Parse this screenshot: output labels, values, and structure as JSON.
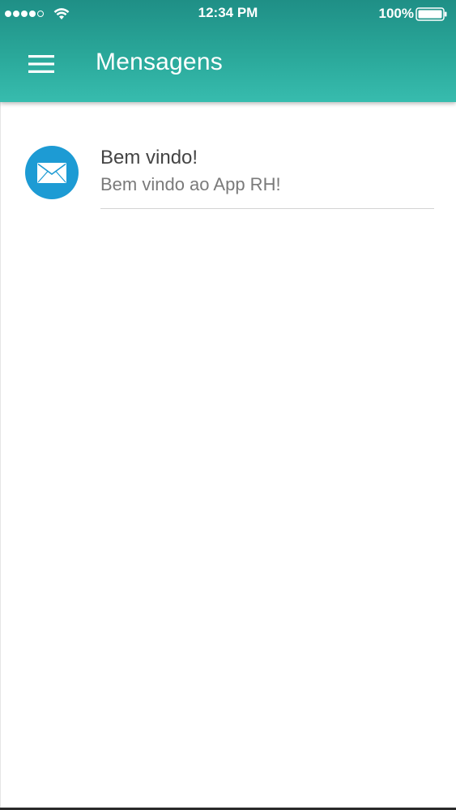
{
  "status_bar": {
    "time": "12:34 PM",
    "battery_percent": "100%",
    "signal_bars": 4,
    "signal_icon": "cellular-signal-icon",
    "wifi_icon": "wifi-icon",
    "battery_icon": "battery-icon"
  },
  "header": {
    "title": "Mensagens",
    "menu_icon": "hamburger-menu-icon",
    "color_top": "#1f8f86",
    "color_bottom": "#37bcae"
  },
  "messages": [
    {
      "title": "Bem vindo!",
      "subtitle": "Bem vindo ao App RH!",
      "icon": "envelope-icon",
      "icon_bg": "#1d9bd4"
    }
  ]
}
